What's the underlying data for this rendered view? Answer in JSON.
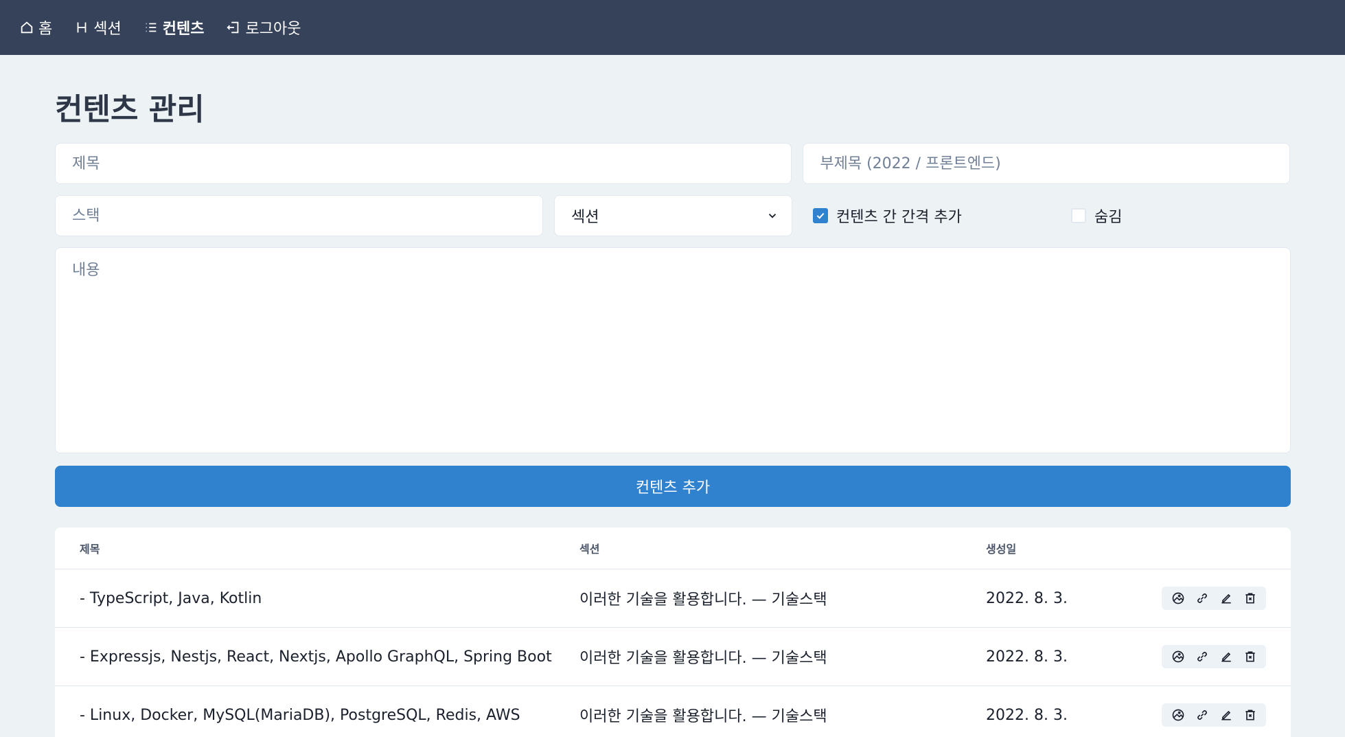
{
  "nav": {
    "items": [
      {
        "label": "홈",
        "icon": "home-icon"
      },
      {
        "label": "섹션",
        "icon": "heading-icon"
      },
      {
        "label": "컨텐츠",
        "icon": "list-icon",
        "active": true
      },
      {
        "label": "로그아웃",
        "icon": "logout-icon"
      }
    ]
  },
  "page": {
    "title": "컨텐츠 관리"
  },
  "form": {
    "title_placeholder": "제목",
    "subtitle_placeholder": "부제목 (2022 / 프론트엔드)",
    "stack_placeholder": "스택",
    "section_select_value": "섹션",
    "gap_checkbox_label": "컨텐츠 간 간격 추가",
    "gap_checkbox_checked": true,
    "hidden_checkbox_label": "숨김",
    "hidden_checkbox_checked": false,
    "content_placeholder": "내용",
    "submit_label": "컨텐츠 추가"
  },
  "table": {
    "headers": [
      "제목",
      "섹션",
      "생성일"
    ],
    "rows": [
      {
        "title": "- TypeScript, Java, Kotlin",
        "section": "이러한 기술을 활용합니다. — 기술스택",
        "created": "2022. 8. 3."
      },
      {
        "title": "- Expressjs, Nestjs, React, Nextjs, Apollo GraphQL, Spring Boot",
        "section": "이러한 기술을 활용합니다. — 기술스택",
        "created": "2022. 8. 3."
      },
      {
        "title": "- Linux, Docker, MySQL(MariaDB), PostgreSQL, Redis, AWS",
        "section": "이러한 기술을 활용합니다. — 기술스택",
        "created": "2022. 8. 3."
      }
    ]
  },
  "colors": {
    "nav_bg": "#364259",
    "page_bg": "#edf2f5",
    "accent": "#3182ce"
  }
}
